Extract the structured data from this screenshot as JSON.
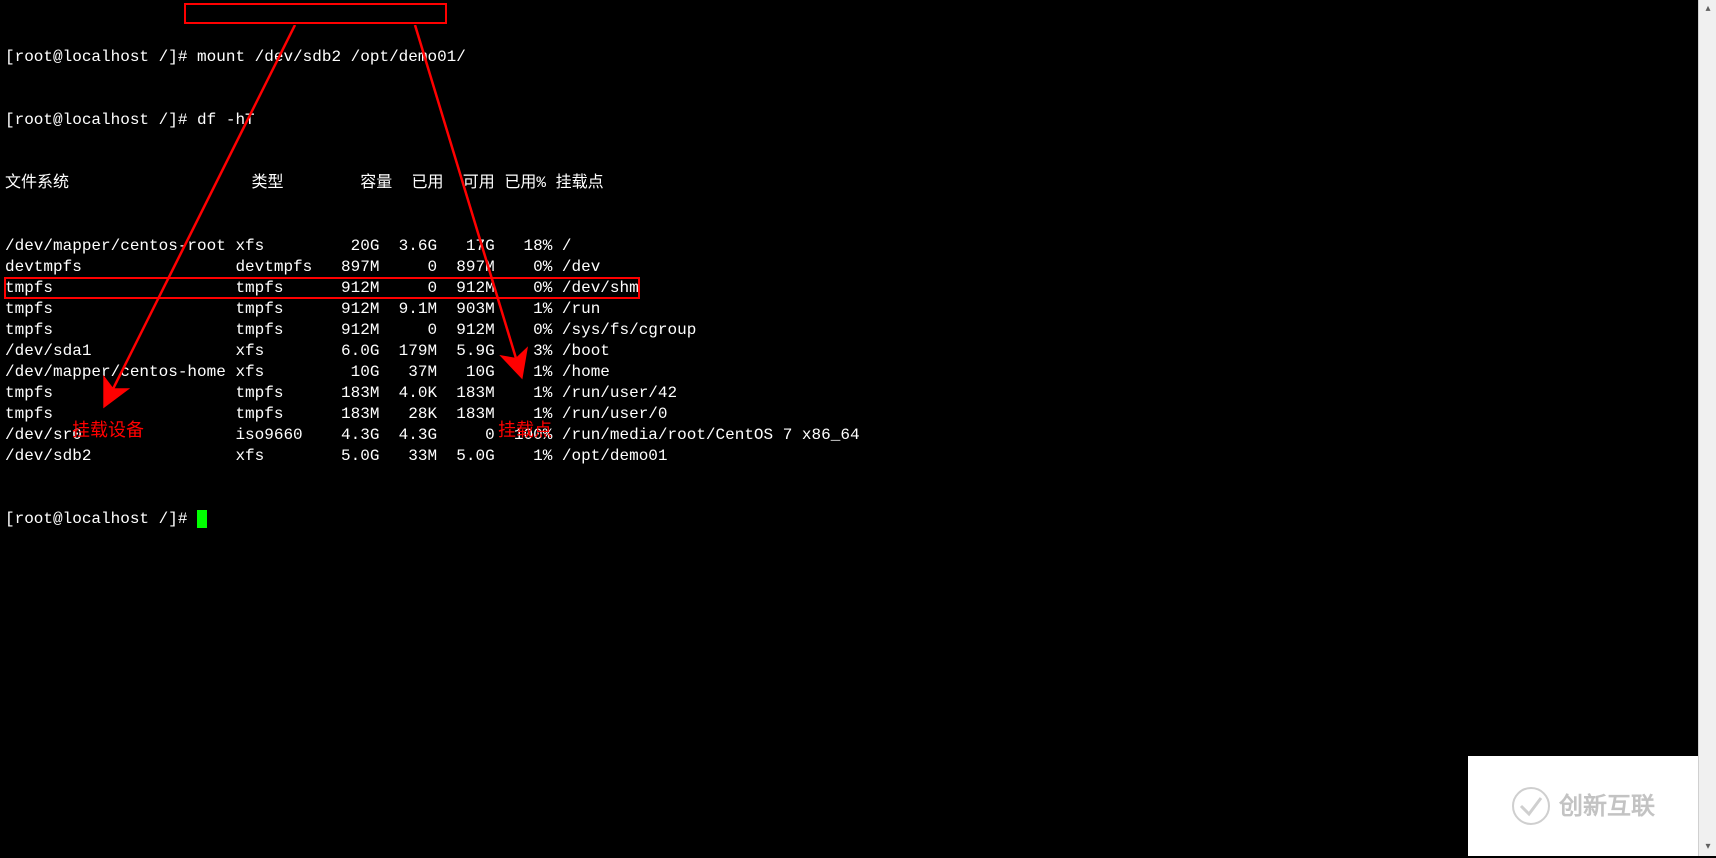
{
  "terminal": {
    "prompt1": "[root@localhost /]# ",
    "command1": "mount /dev/sdb2 /opt/demo01/",
    "prompt2": "[root@localhost /]# ",
    "command2": "df -hT",
    "prompt3": "[root@localhost /]# ",
    "headers": {
      "filesystem": "文件系统",
      "type": "类型",
      "size": "容量",
      "used": "已用",
      "avail": "可用",
      "usepct": "已用%",
      "mount": "挂载点"
    },
    "rows": [
      {
        "fs": "/dev/mapper/centos-root",
        "type": "xfs",
        "size": "20G",
        "used": "3.6G",
        "avail": "17G",
        "usepct": "18%",
        "mount": "/"
      },
      {
        "fs": "devtmpfs",
        "type": "devtmpfs",
        "size": "897M",
        "used": "0",
        "avail": "897M",
        "usepct": "0%",
        "mount": "/dev"
      },
      {
        "fs": "tmpfs",
        "type": "tmpfs",
        "size": "912M",
        "used": "0",
        "avail": "912M",
        "usepct": "0%",
        "mount": "/dev/shm"
      },
      {
        "fs": "tmpfs",
        "type": "tmpfs",
        "size": "912M",
        "used": "9.1M",
        "avail": "903M",
        "usepct": "1%",
        "mount": "/run"
      },
      {
        "fs": "tmpfs",
        "type": "tmpfs",
        "size": "912M",
        "used": "0",
        "avail": "912M",
        "usepct": "0%",
        "mount": "/sys/fs/cgroup"
      },
      {
        "fs": "/dev/sda1",
        "type": "xfs",
        "size": "6.0G",
        "used": "179M",
        "avail": "5.9G",
        "usepct": "3%",
        "mount": "/boot"
      },
      {
        "fs": "/dev/mapper/centos-home",
        "type": "xfs",
        "size": "10G",
        "used": "37M",
        "avail": "10G",
        "usepct": "1%",
        "mount": "/home"
      },
      {
        "fs": "tmpfs",
        "type": "tmpfs",
        "size": "183M",
        "used": "4.0K",
        "avail": "183M",
        "usepct": "1%",
        "mount": "/run/user/42"
      },
      {
        "fs": "tmpfs",
        "type": "tmpfs",
        "size": "183M",
        "used": "28K",
        "avail": "183M",
        "usepct": "1%",
        "mount": "/run/user/0"
      },
      {
        "fs": "/dev/sr0",
        "type": "iso9660",
        "size": "4.3G",
        "used": "4.3G",
        "avail": "0",
        "usepct": "100%",
        "mount": "/run/media/root/CentOS 7 x86_64"
      },
      {
        "fs": "/dev/sdb2",
        "type": "xfs",
        "size": "5.0G",
        "used": "33M",
        "avail": "5.0G",
        "usepct": "1%",
        "mount": "/opt/demo01"
      }
    ]
  },
  "annotations": {
    "label1": "挂载设备",
    "label2": "挂载点"
  },
  "watermark": {
    "text": "创新互联"
  }
}
